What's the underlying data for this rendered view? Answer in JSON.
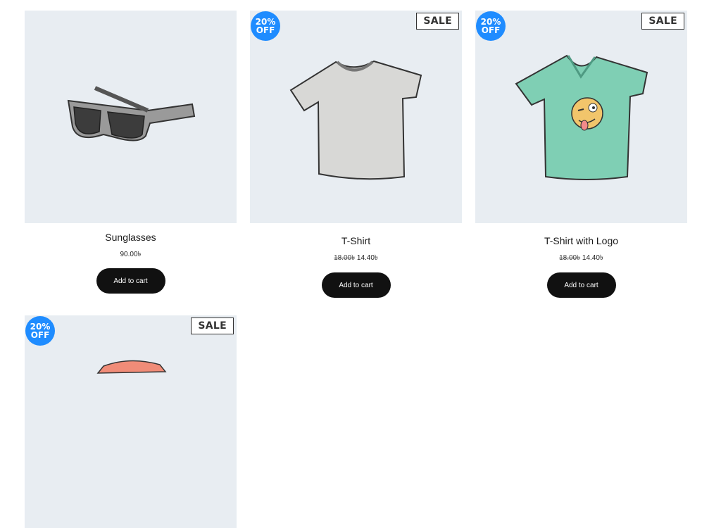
{
  "products": [
    {
      "name": "Sunglasses",
      "price": "90.00৳",
      "regular_price": "",
      "add_label": "Add to cart",
      "badge_pct": "",
      "badge_off": "",
      "sale": ""
    },
    {
      "name": "T-Shirt",
      "price": "14.40৳",
      "regular_price": "18.00৳",
      "add_label": "Add to cart",
      "badge_pct": "20%",
      "badge_off": "OFF",
      "sale": "SALE"
    },
    {
      "name": "T-Shirt with Logo",
      "price": "14.40৳",
      "regular_price": "18.00৳",
      "add_label": "Add to cart",
      "badge_pct": "20%",
      "badge_off": "OFF",
      "sale": "SALE"
    },
    {
      "name": "",
      "price": "",
      "regular_price": "",
      "add_label": "",
      "badge_pct": "20%",
      "badge_off": "OFF",
      "sale": "SALE"
    }
  ],
  "colors": {
    "badge": "#1f8cff",
    "tile_bg": "#e8edf2",
    "button": "#111111"
  }
}
